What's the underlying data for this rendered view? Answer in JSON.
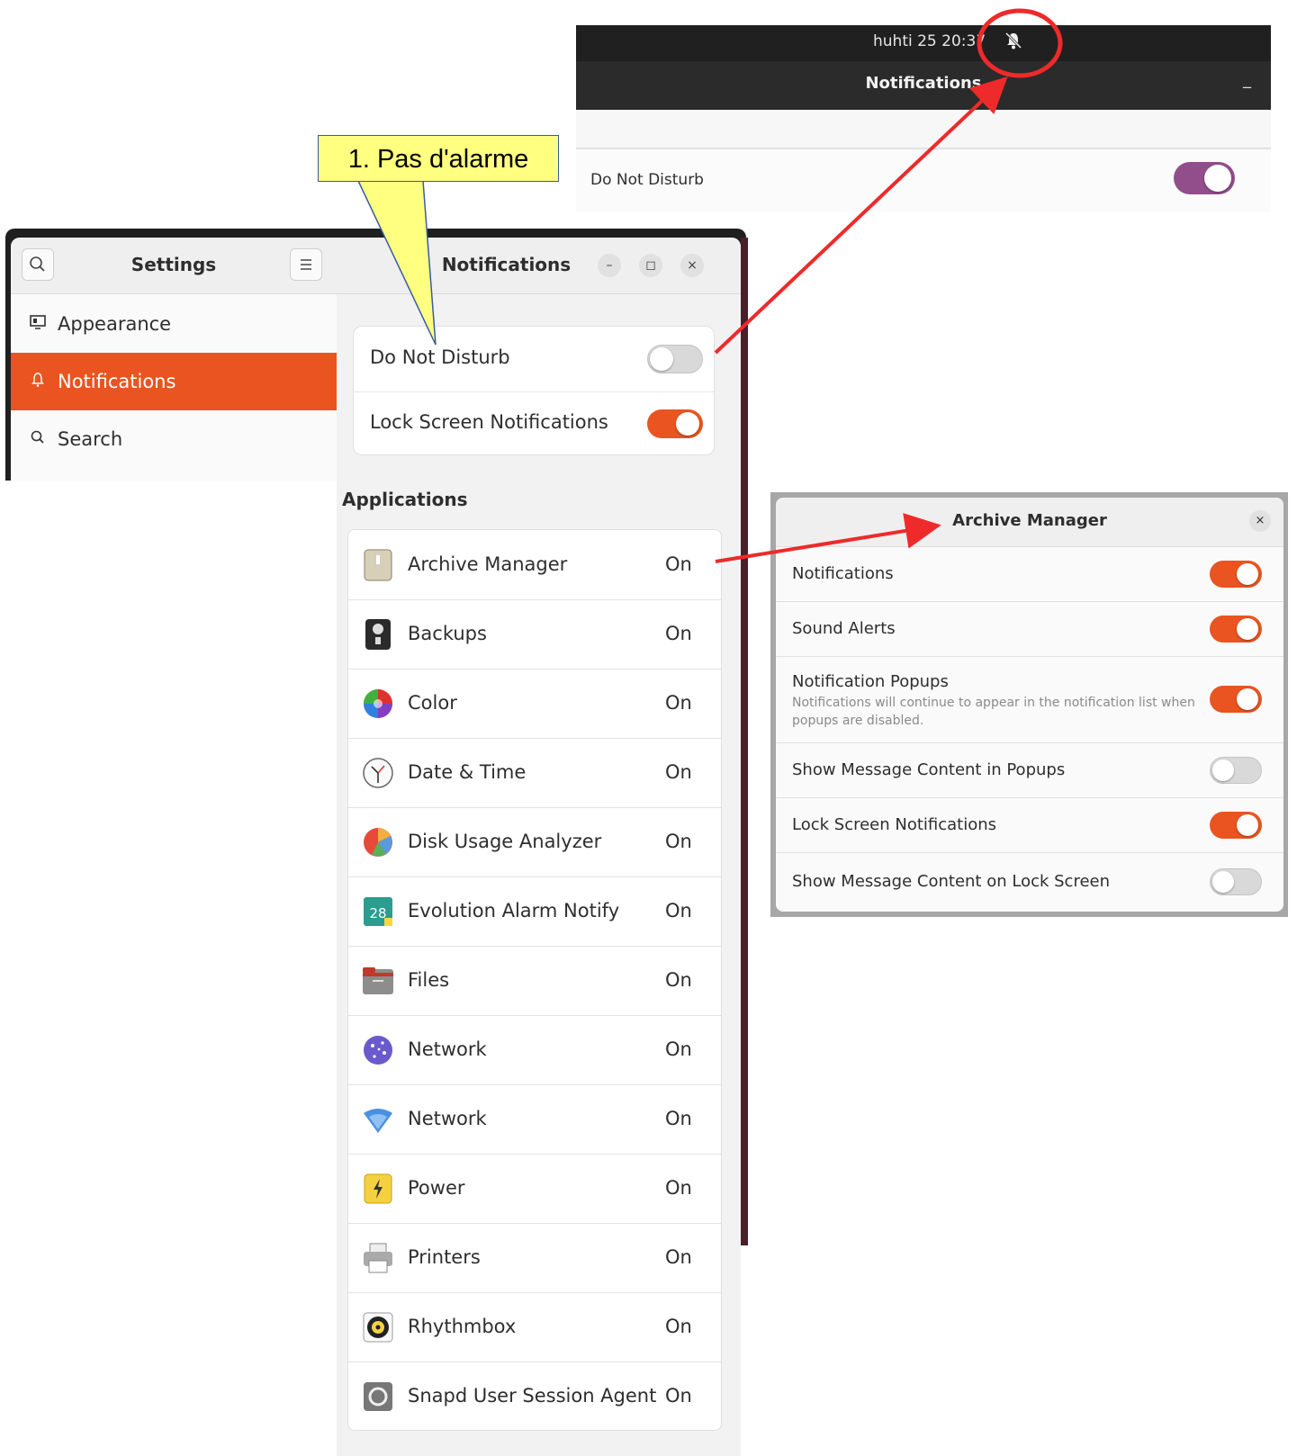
{
  "top_panel": {
    "clock": "huhti 25 20:37",
    "header_title": "Notifications",
    "minimize_label": "_",
    "dnd_label": "Do Not Disturb",
    "dnd_on": true,
    "dnd_color": "#924d8b"
  },
  "callout": {
    "text": "1. Pas d'alarme",
    "color": "#ffff80"
  },
  "settings": {
    "sidebar_title": "Settings",
    "sidebar_items": [
      {
        "label": "Appearance",
        "icon": "appearance-icon",
        "active": false
      },
      {
        "label": "Notifications",
        "icon": "bell-icon",
        "active": true
      },
      {
        "label": "Search",
        "icon": "search-icon",
        "active": false
      }
    ],
    "content_title": "Notifications",
    "window_buttons": {
      "minimize": "–",
      "maximize": "◻",
      "close": "×"
    },
    "general": [
      {
        "label": "Do Not Disturb",
        "on": false
      },
      {
        "label": "Lock Screen Notifications",
        "on": true
      }
    ],
    "applications_title": "Applications",
    "applications": [
      {
        "name": "Archive Manager",
        "value": "On",
        "icon": "archive-manager-icon"
      },
      {
        "name": "Backups",
        "value": "On",
        "icon": "backups-icon"
      },
      {
        "name": "Color",
        "value": "On",
        "icon": "color-icon"
      },
      {
        "name": "Date & Time",
        "value": "On",
        "icon": "clock-icon"
      },
      {
        "name": "Disk Usage Analyzer",
        "value": "On",
        "icon": "disk-usage-icon"
      },
      {
        "name": "Evolution Alarm Notify",
        "value": "On",
        "icon": "evolution-calendar-icon"
      },
      {
        "name": "Files",
        "value": "On",
        "icon": "folder-icon"
      },
      {
        "name": "Network",
        "value": "On",
        "icon": "network-globe-icon"
      },
      {
        "name": "Network",
        "value": "On",
        "icon": "wifi-icon"
      },
      {
        "name": "Power",
        "value": "On",
        "icon": "power-icon"
      },
      {
        "name": "Printers",
        "value": "On",
        "icon": "printer-icon"
      },
      {
        "name": "Rhythmbox",
        "value": "On",
        "icon": "rhythmbox-icon"
      },
      {
        "name": "Snapd User Session Agent",
        "value": "On",
        "icon": "snapd-icon"
      }
    ]
  },
  "archive_dialog": {
    "title": "Archive Manager",
    "close_label": "×",
    "rows": [
      {
        "label": "Notifications",
        "on": true
      },
      {
        "label": "Sound Alerts",
        "on": true
      },
      {
        "label": "Notification Popups",
        "sub": "Notifications will continue to appear in the notification list when popups are disabled.",
        "on": true
      },
      {
        "label": "Show Message Content in Popups",
        "on": false
      },
      {
        "label": "Lock Screen Notifications",
        "on": true
      },
      {
        "label": "Show Message Content on Lock Screen",
        "on": false
      }
    ]
  },
  "colors": {
    "accent": "#e95420",
    "annotation_red": "#ee2a2a",
    "dark_bar": "#202020"
  }
}
